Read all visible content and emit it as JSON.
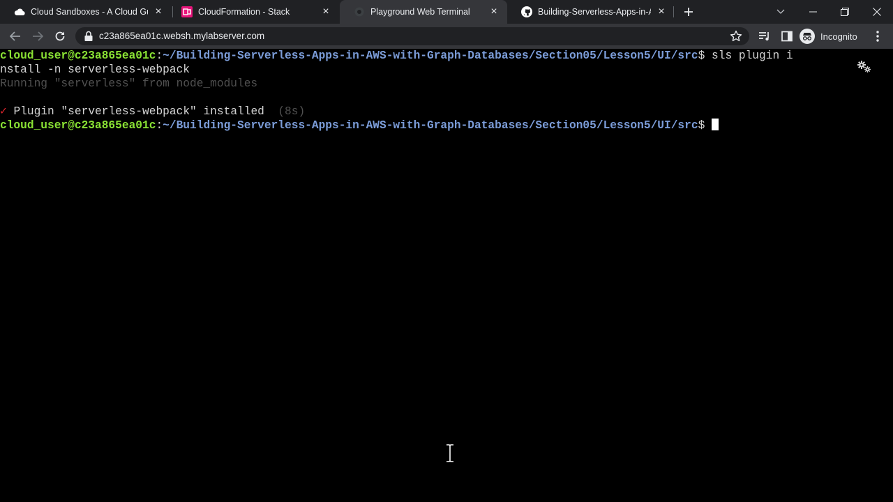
{
  "browser": {
    "tabs": [
      {
        "title": "Cloud Sandboxes - A Cloud Guru",
        "icon": "cloud-icon",
        "active": false
      },
      {
        "title": "CloudFormation - Stack",
        "icon": "cloudformation-icon",
        "active": false
      },
      {
        "title": "Playground Web Terminal",
        "icon": "terminal-icon",
        "active": true
      },
      {
        "title": "Building-Serverless-Apps-in-AWS",
        "icon": "github-icon",
        "active": false
      }
    ],
    "url": "c23a865ea01c.websh.mylabserver.com",
    "profile_label": "Incognito"
  },
  "terminal": {
    "line1": {
      "user": "cloud_user@c23a865ea01c",
      "colon": ":",
      "path": "~/Building-Serverless-Apps-in-AWS-with-Graph-Databases/Section05/Lesson5/UI/src",
      "symbol": "$ ",
      "command": "sls plugin i"
    },
    "line2": "nstall -n serverless-webpack",
    "line3": "Running \"serverless\" from node_modules",
    "line5": {
      "check": "✓",
      "text": " Plugin \"serverless-webpack\" installed  ",
      "timing": "(8s)"
    },
    "line6": {
      "user": "cloud_user@c23a865ea01c",
      "colon": ":",
      "path": "~/Building-Serverless-Apps-in-AWS-with-Graph-Databases/Section05/Lesson5/UI/src",
      "symbol": "$ "
    }
  },
  "colors": {
    "prompt_user": "#8ae234",
    "prompt_path": "#7b9cd8",
    "check": "#e0242c",
    "terminal_bg": "#000000",
    "tabstrip_bg": "#202124",
    "toolbar_bg": "#35363a"
  }
}
